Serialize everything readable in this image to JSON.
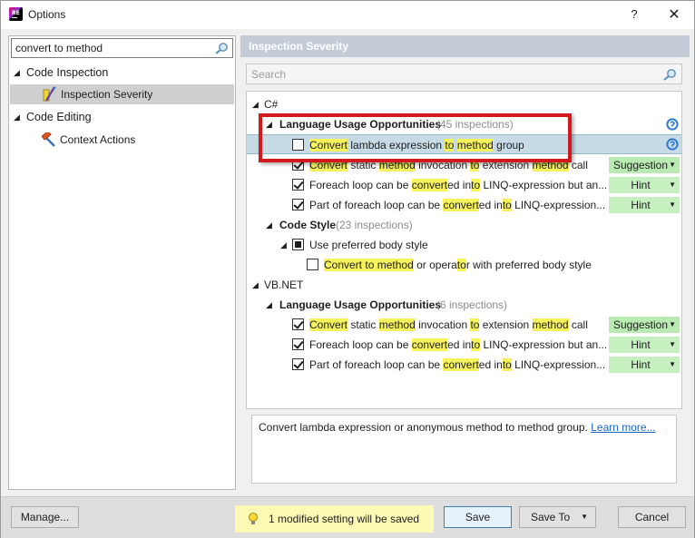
{
  "window": {
    "title": "Options",
    "help_label": "?",
    "close_label": "✕",
    "app_icon_text": "RE"
  },
  "left": {
    "search_value": "convert to method",
    "tree": [
      {
        "label": "Code Inspection"
      },
      {
        "label": "Inspection Severity",
        "selected": true
      },
      {
        "label": "Code Editing"
      },
      {
        "label": "Context Actions"
      }
    ]
  },
  "right": {
    "header": "Inspection Severity",
    "search_placeholder": "Search",
    "cs": {
      "lang": "C#",
      "group1": {
        "title": "Language Usage Opportunities",
        "count": "(45 inspections)"
      },
      "item1": {
        "p1": "Convert",
        "p2": " lambda expression ",
        "p3": "to",
        "p4": " ",
        "p5": "method",
        "p6": " group"
      },
      "item2": {
        "p1": "Convert",
        "p2": " static ",
        "p3": "method",
        "p4": " invocation ",
        "p5": "to",
        "p6": " extension ",
        "p7": "method",
        "p8": " call",
        "severity": "Suggestion"
      },
      "item3": {
        "p1": "Foreach loop can be ",
        "p2": "convert",
        "p3": "ed in",
        "p4": "to",
        "p5": " LINQ-expression but an...",
        "severity": "Hint"
      },
      "item4": {
        "p1": "Part of foreach loop can be ",
        "p2": "convert",
        "p3": "ed in",
        "p4": "to",
        "p5": " LINQ-expression...",
        "severity": "Hint"
      },
      "group2": {
        "title": "Code Style",
        "count": "(23 inspections)"
      },
      "item5": {
        "label": "Use preferred body style"
      },
      "item6": {
        "p1": "Convert",
        "p2": " ",
        "p3": "to",
        "p4": " ",
        "p5": "method",
        "p6": " or opera",
        "p7": "to",
        "p8": "r with preferred body style"
      }
    },
    "vb": {
      "lang": "VB.NET",
      "group1": {
        "title": "Language Usage Opportunities",
        "count": "(6 inspections)"
      },
      "item1": {
        "p1": "Convert",
        "p2": " static ",
        "p3": "method",
        "p4": " invocation ",
        "p5": "to",
        "p6": " extension ",
        "p7": "method",
        "p8": " call",
        "severity": "Suggestion"
      },
      "item2": {
        "p1": "Foreach loop can be ",
        "p2": "convert",
        "p3": "ed in",
        "p4": "to",
        "p5": " LINQ-expression but an...",
        "severity": "Hint"
      },
      "item3": {
        "p1": "Part of foreach loop can be ",
        "p2": "convert",
        "p3": "ed in",
        "p4": "to",
        "p5": " LINQ-expression...",
        "severity": "Hint"
      }
    },
    "description": {
      "text": "Convert lambda expression or anonymous method to method group.",
      "link": "Learn more..."
    }
  },
  "bottom": {
    "manage": "Manage...",
    "notice": "1 modified setting will be saved",
    "save": "Save",
    "save_to": "Save To",
    "cancel": "Cancel"
  },
  "colors": {
    "highlight": "#f5f25c",
    "selected_row": "#c7dbe7",
    "callout": "#d3191f",
    "link": "#1a66c9"
  }
}
